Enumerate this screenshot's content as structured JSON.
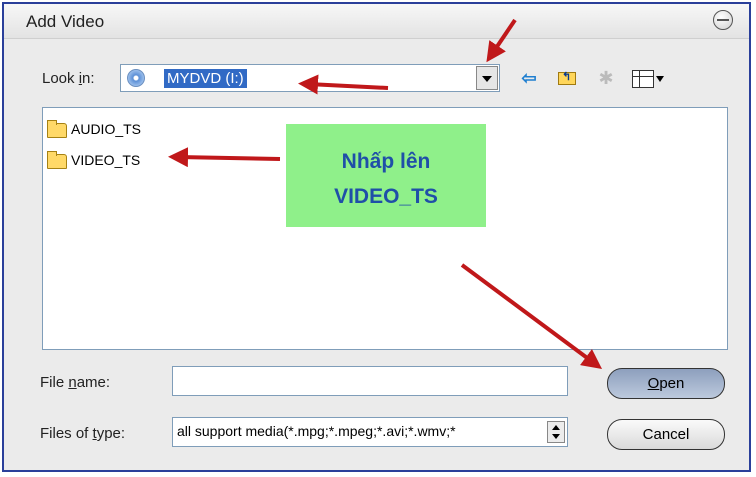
{
  "window": {
    "title": "Add Video"
  },
  "lookin": {
    "label_pre": "Look ",
    "label_mnemonic": "i",
    "label_post": "n:",
    "value": "MYDVD (I:)"
  },
  "toolbar": {
    "icons": [
      "back-arrow-icon",
      "up-folder-icon",
      "new-folder-icon",
      "view-menu-icon"
    ]
  },
  "files": [
    {
      "name": "AUDIO_TS",
      "icon": "folder-icon"
    },
    {
      "name": "VIDEO_TS",
      "icon": "folder-icon"
    }
  ],
  "callout": {
    "line1": "Nhấp lên",
    "line2": "VIDEO_TS",
    "color": "#8ff08a",
    "text_color": "#1f4fa8"
  },
  "filename": {
    "label_pre": "File ",
    "label_mnemonic": "n",
    "label_post": "ame:",
    "value": ""
  },
  "filetype": {
    "label_pre": "Files of ",
    "label_mnemonic": "t",
    "label_post": "ype:",
    "value": "all support media(*.mpg;*.mpeg;*.avi;*.wmv;*"
  },
  "buttons": {
    "open_mnemonic": "O",
    "open_rest": "pen",
    "cancel": "Cancel"
  },
  "colors": {
    "arrow": "#c0181a",
    "selection": "#316ac5",
    "frame": "#2a3f9a"
  }
}
